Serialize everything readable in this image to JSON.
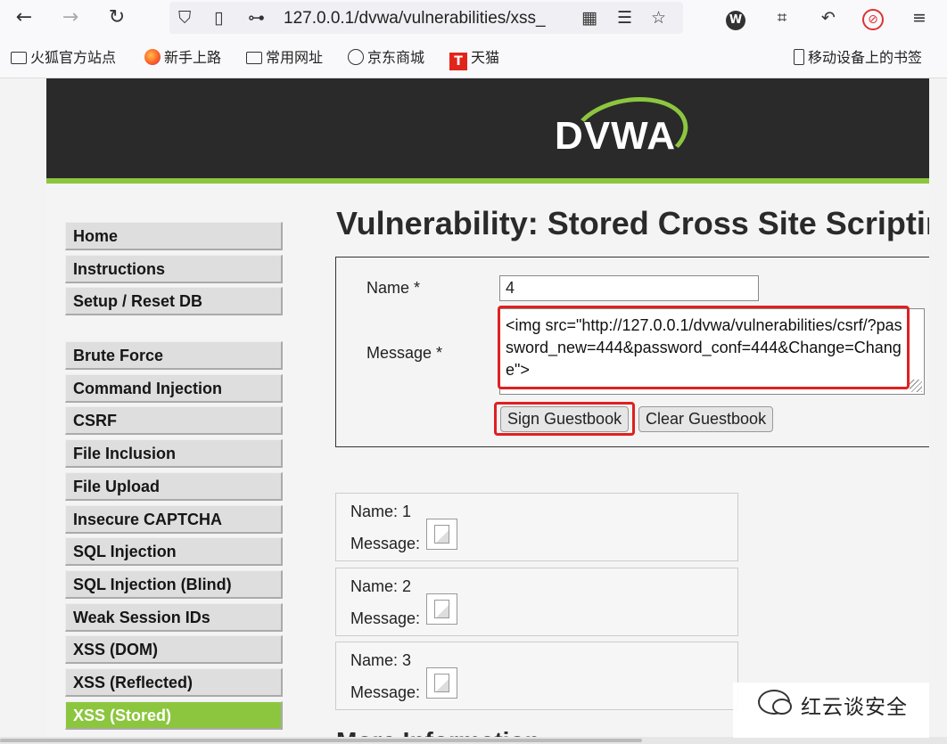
{
  "browser": {
    "url": "127.0.0.1/dvwa/vulnerabilities/xss_",
    "bookmarks": [
      "火狐官方站点",
      "新手上路",
      "常用网址",
      "京东商城",
      "天猫"
    ],
    "mobile_bookmarks": "移动设备上的书签"
  },
  "dvwa": {
    "logo": "DVWA",
    "page_title": "Vulnerability: Stored Cross Site Scripting",
    "menu_group1": [
      "Home",
      "Instructions",
      "Setup / Reset DB"
    ],
    "menu_group2": [
      "Brute Force",
      "Command Injection",
      "CSRF",
      "File Inclusion",
      "File Upload",
      "Insecure CAPTCHA",
      "SQL Injection",
      "SQL Injection (Blind)",
      "Weak Session IDs",
      "XSS (DOM)",
      "XSS (Reflected)",
      "XSS (Stored)"
    ],
    "active_menu": "XSS (Stored)",
    "form": {
      "name_label": "Name *",
      "name_value": "4",
      "message_label": "Message *",
      "message_value": "<img src=\"http://127.0.0.1/dvwa/vulnerabilities/csrf/?password_new=444&password_conf=444&Change=Change\">",
      "sign_button": "Sign Guestbook",
      "clear_button": "Clear Guestbook"
    },
    "entries": [
      {
        "name": "Name: 1",
        "message": "Message:"
      },
      {
        "name": "Name: 2",
        "message": "Message:"
      },
      {
        "name": "Name: 3",
        "message": "Message:"
      }
    ],
    "more_info": "More Information"
  },
  "watermark": "红云谈安全"
}
